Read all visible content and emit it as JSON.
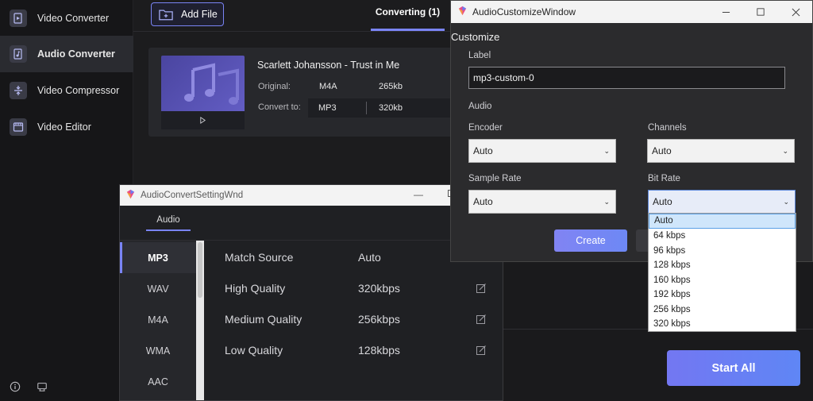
{
  "sidebar": {
    "items": [
      {
        "label": "Video Converter",
        "icon": "video-converter-icon",
        "active": false
      },
      {
        "label": "Audio Converter",
        "icon": "audio-converter-icon",
        "active": true
      },
      {
        "label": "Video Compressor",
        "icon": "video-compressor-icon",
        "active": false
      },
      {
        "label": "Video Editor",
        "icon": "video-editor-icon",
        "active": false
      }
    ],
    "bottom_icons": [
      "info-icon",
      "feedback-icon"
    ]
  },
  "toolbar": {
    "add_file_label": "Add File",
    "converting_tab": "Converting (1)"
  },
  "file": {
    "title": "Scarlett Johansson - Trust in Me",
    "original_label": "Original:",
    "original_format": "M4A",
    "original_size": "265kb",
    "convert_to_label": "Convert to:",
    "target_format": "MP3",
    "target_bitrate": "320kb"
  },
  "start_all_label": "Start All",
  "setting_window": {
    "title": "AudioConvertSettingWnd",
    "minimize_glyph": "—",
    "tab": "Audio",
    "formats": [
      "MP3",
      "WAV",
      "M4A",
      "WMA",
      "AAC"
    ],
    "selected_format": "MP3",
    "qualities": [
      {
        "name": "Match Source",
        "value": "Auto",
        "editable": false
      },
      {
        "name": "High Quality",
        "value": "320kbps",
        "editable": true
      },
      {
        "name": "Medium Quality",
        "value": "256kbps",
        "editable": true
      },
      {
        "name": "Low Quality",
        "value": "128kbps",
        "editable": true
      }
    ]
  },
  "customize_window": {
    "title": "AudioCustomizeWindow",
    "heading": "Customize",
    "label_caption": "Label",
    "label_value": "mp3-custom-0",
    "audio_caption": "Audio",
    "encoder_caption": "Encoder",
    "encoder_value": "Auto",
    "channels_caption": "Channels",
    "channels_value": "Auto",
    "sample_rate_caption": "Sample Rate",
    "sample_rate_value": "Auto",
    "bit_rate_caption": "Bit Rate",
    "bit_rate_value": "Auto",
    "create_label": "Create",
    "bit_rate_options": [
      "Auto",
      "64 kbps",
      "96 kbps",
      "128 kbps",
      "160 kbps",
      "192 kbps",
      "256 kbps",
      "320 kbps"
    ],
    "highlighted_option": "Auto"
  },
  "colors": {
    "accent": "#7a84f5",
    "sidebar_active": "#2a2b30",
    "start_gradient_a": "#7377f2",
    "start_gradient_b": "#5f86f5"
  }
}
